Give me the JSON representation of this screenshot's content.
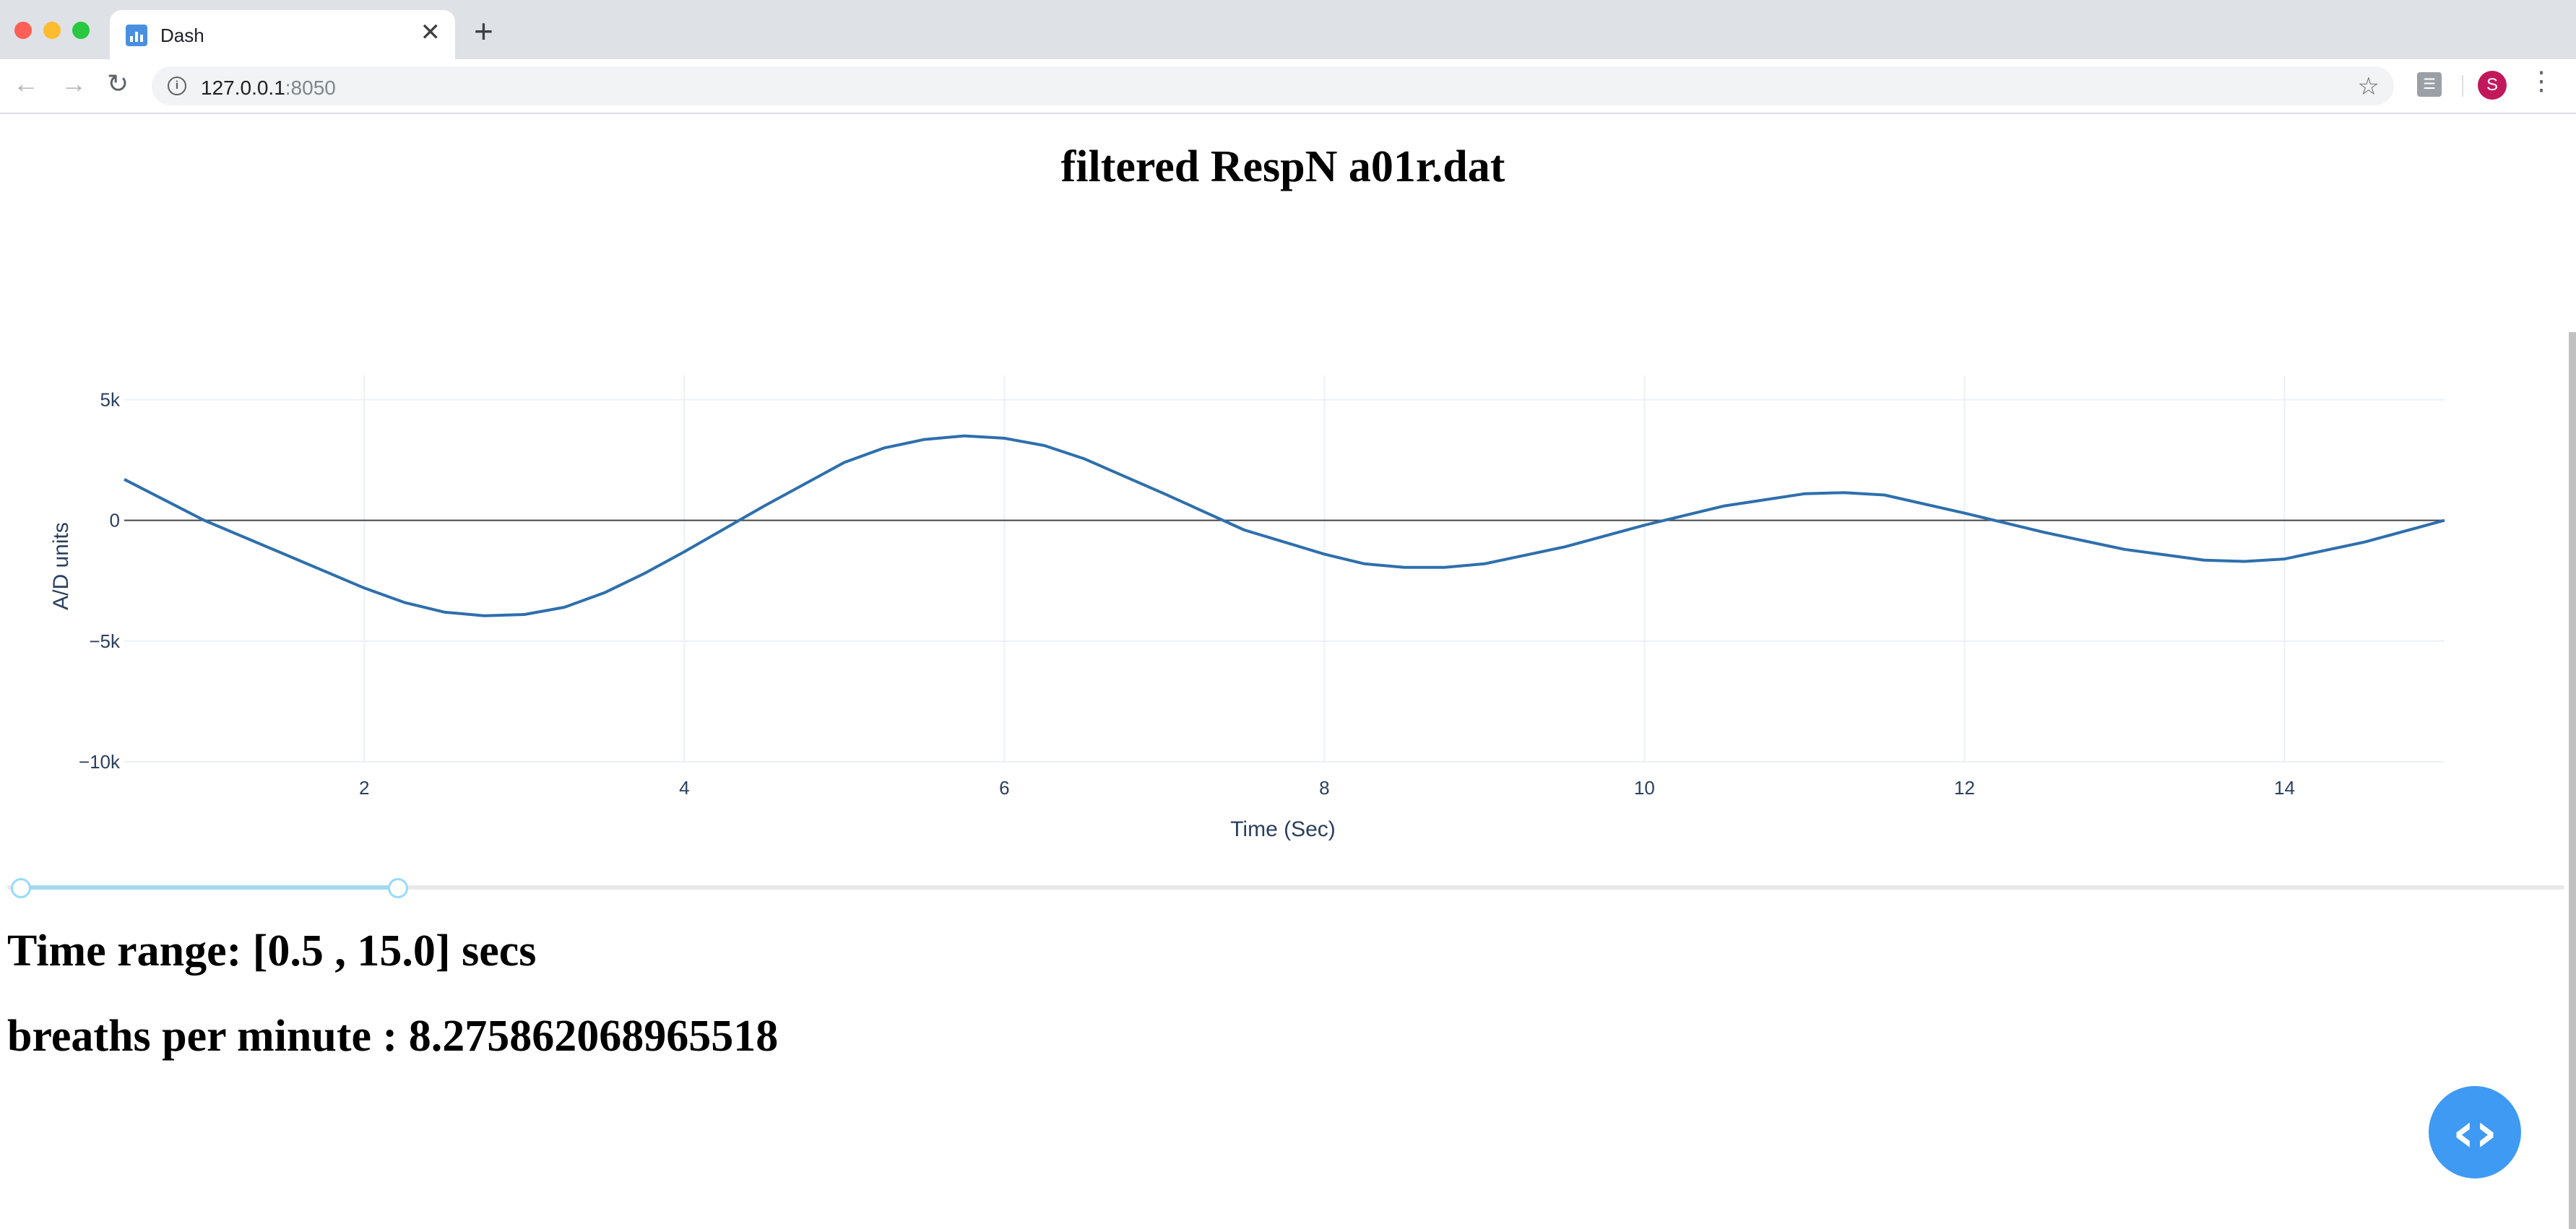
{
  "browser": {
    "tab_title": "Dash",
    "tab_close": "✕",
    "new_tab": "+",
    "url_host": "127.0.0.1",
    "url_port": ":8050",
    "avatar_letter": "S",
    "icons": [
      "back-arrow-icon",
      "forward-arrow-icon",
      "reload-icon",
      "info-icon",
      "star-icon",
      "extension-icon",
      "menu-dots-icon"
    ]
  },
  "page": {
    "title": "filtered RespN a01r.dat",
    "time_range_text": "Time range: [0.5 , 15.0] secs",
    "bpm_text": "breaths per minute : 8.275862068965518"
  },
  "range_slider": {
    "min": 0.5,
    "max": 15.0,
    "selected": [
      0.5,
      15.0
    ],
    "fill_fraction": 0.15
  },
  "dev_tools": {
    "icon": "code-brackets-icon"
  },
  "chart_data": {
    "type": "line",
    "title": "",
    "xlabel": "Time (Sec)",
    "ylabel": "A/D units",
    "xlim": [
      0.5,
      15.0
    ],
    "ylim": [
      -10000,
      6000
    ],
    "xticks": [
      2,
      4,
      6,
      8,
      10,
      12,
      14
    ],
    "xtick_labels": [
      "2",
      "4",
      "6",
      "8",
      "10",
      "12",
      "14"
    ],
    "yticks": [
      5000,
      0,
      -5000,
      -10000
    ],
    "ytick_labels": [
      "5k",
      "0",
      "−5k",
      "−10k"
    ],
    "grid": true,
    "zero_line": true,
    "line_color": "#2e6fad",
    "x": [
      0.5,
      1.0,
      1.5,
      2.0,
      2.25,
      2.5,
      2.75,
      3.0,
      3.25,
      3.5,
      3.75,
      4.0,
      4.5,
      5.0,
      5.25,
      5.5,
      5.75,
      6.0,
      6.25,
      6.5,
      7.0,
      7.5,
      8.0,
      8.25,
      8.5,
      8.75,
      9.0,
      9.5,
      10.0,
      10.5,
      11.0,
      11.25,
      11.5,
      12.0,
      12.5,
      13.0,
      13.5,
      13.75,
      14.0,
      14.5,
      15.0
    ],
    "y": [
      1700,
      0,
      -1400,
      -2800,
      -3400,
      -3800,
      -3950,
      -3900,
      -3600,
      -3000,
      -2200,
      -1300,
      600,
      2400,
      3000,
      3350,
      3500,
      3400,
      3100,
      2550,
      1100,
      -400,
      -1400,
      -1800,
      -1950,
      -1950,
      -1800,
      -1100,
      -200,
      600,
      1100,
      1150,
      1050,
      300,
      -500,
      -1200,
      -1650,
      -1700,
      -1600,
      -900,
      0
    ]
  }
}
